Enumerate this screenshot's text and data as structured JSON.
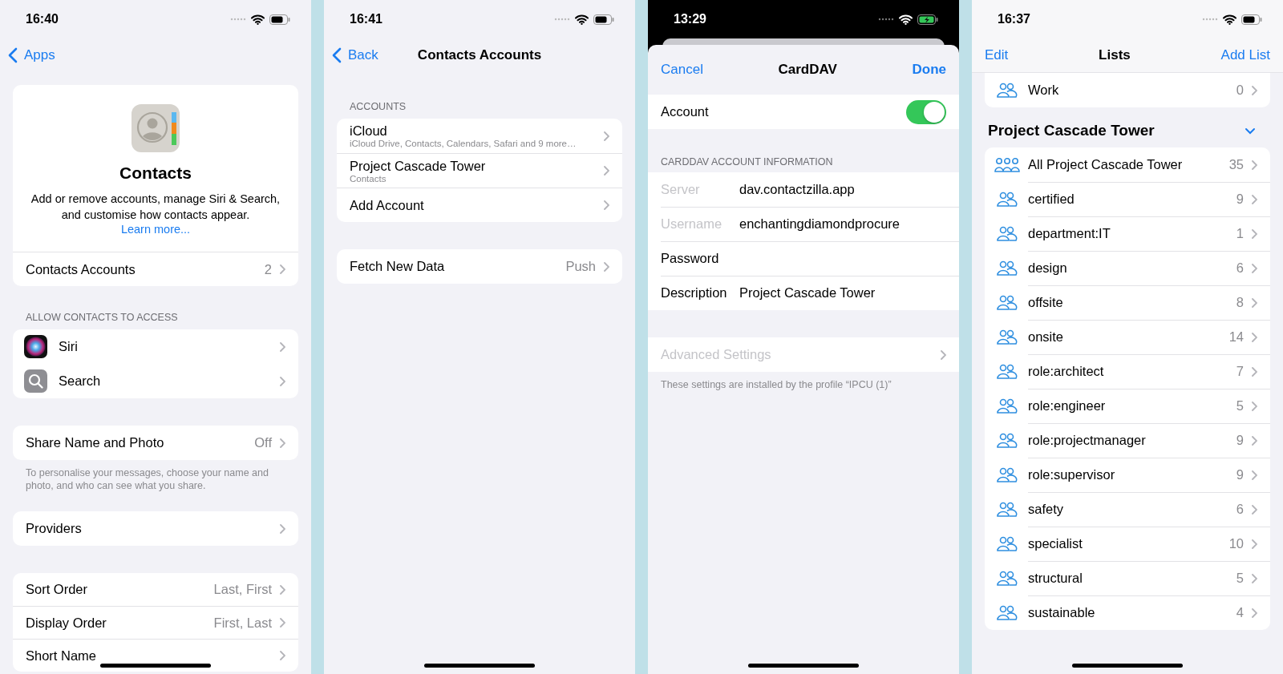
{
  "settings": {
    "status_bar": {
      "time": "16:40",
      "charging": false
    },
    "back": "Apps",
    "app": {
      "name": "Contacts",
      "description": "Add or remove accounts, manage Siri & Search, and customise how contacts appear.",
      "link": "Learn more..."
    },
    "accounts_row": {
      "label": "Contacts Accounts",
      "value": "2"
    },
    "access_header": "ALLOW CONTACTS TO ACCESS",
    "access_items": [
      {
        "label": "Siri",
        "kind": "siri"
      },
      {
        "label": "Search",
        "kind": "search"
      }
    ],
    "share_row": {
      "label": "Share Name and Photo",
      "value": "Off"
    },
    "share_note": "To personalise your messages, choose your name and photo, and who can see what you share.",
    "providers": {
      "label": "Providers"
    },
    "order_rows": [
      {
        "label": "Sort Order",
        "value": "Last, First"
      },
      {
        "label": "Display Order",
        "value": "First, Last"
      },
      {
        "label": "Short Name"
      }
    ]
  },
  "accounts": {
    "status_bar": {
      "time": "16:41",
      "charging": false
    },
    "back": "Back",
    "title": "Contacts Accounts",
    "header": "ACCOUNTS",
    "items": [
      {
        "name": "iCloud",
        "detail": "iCloud Drive, Contacts, Calendars, Safari and 9 more…"
      },
      {
        "name": "Project Cascade Tower",
        "detail": "Contacts"
      },
      {
        "name": "Add Account"
      }
    ],
    "fetch": {
      "label": "Fetch New Data",
      "value": "Push"
    }
  },
  "carddav": {
    "status_bar": {
      "time": "13:29",
      "charging": true
    },
    "cancel": "Cancel",
    "title": "CardDAV",
    "done": "Done",
    "account": {
      "label": "Account",
      "on": true
    },
    "header": "CARDDAV ACCOUNT INFORMATION",
    "fields": [
      {
        "label": "Server",
        "value": "dav.contactzilla.app",
        "disabled": true
      },
      {
        "label": "Username",
        "value": "enchantingdiamondprocure",
        "disabled": true
      },
      {
        "label": "Password",
        "disabled": false
      },
      {
        "label": "Description",
        "value": "Project Cascade Tower",
        "disabled": false
      }
    ],
    "advanced": {
      "label": "Advanced Settings",
      "disabled": true
    },
    "note": "These settings are installed by the profile “IPCU (1)”"
  },
  "lists": {
    "status_bar": {
      "time": "16:37",
      "charging": false
    },
    "edit": "Edit",
    "title": "Lists",
    "add": "Add List",
    "previous_row": {
      "name": "Work",
      "count": "0"
    },
    "group": {
      "title": "Project Cascade Tower",
      "expanded": true,
      "items": [
        {
          "name": "All Project Cascade Tower",
          "count": "35",
          "kind": "all"
        },
        {
          "name": "certified",
          "count": "9",
          "kind": "list"
        },
        {
          "name": "department:IT",
          "count": "1",
          "kind": "list"
        },
        {
          "name": "design",
          "count": "6",
          "kind": "list"
        },
        {
          "name": "offsite",
          "count": "8",
          "kind": "list"
        },
        {
          "name": "onsite",
          "count": "14",
          "kind": "list"
        },
        {
          "name": "role:architect",
          "count": "7",
          "kind": "list"
        },
        {
          "name": "role:engineer",
          "count": "5",
          "kind": "list"
        },
        {
          "name": "role:projectmanager",
          "count": "9",
          "kind": "list"
        },
        {
          "name": "role:supervisor",
          "count": "9",
          "kind": "list"
        },
        {
          "name": "safety",
          "count": "6",
          "kind": "list"
        },
        {
          "name": "specialist",
          "count": "10",
          "kind": "list"
        },
        {
          "name": "structural",
          "count": "5",
          "kind": "list"
        },
        {
          "name": "sustainable",
          "count": "4",
          "kind": "list"
        }
      ]
    }
  }
}
